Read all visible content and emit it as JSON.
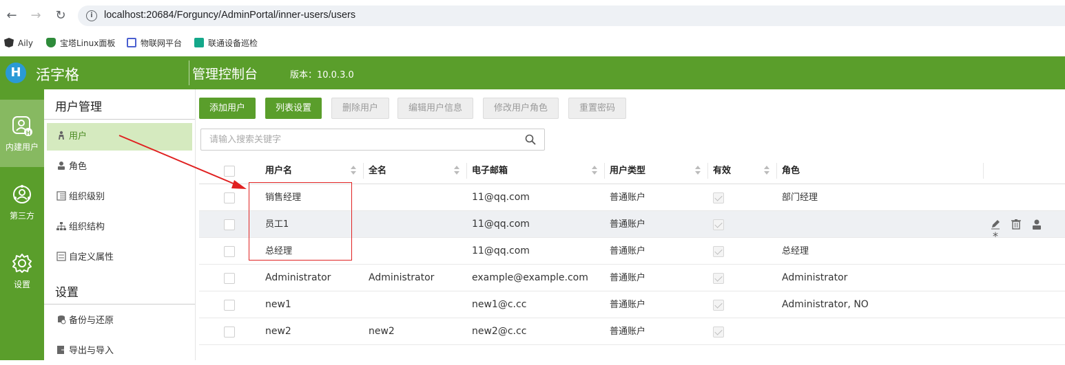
{
  "browser": {
    "url": "localhost:20684/Forguncy/AdminPortal/inner-users/users",
    "bookmarks": [
      {
        "label": "Aily",
        "icon": "angular-icon"
      },
      {
        "label": "宝塔Linux面板",
        "icon": "shield-icon"
      },
      {
        "label": "物联网平台",
        "icon": "cube-icon"
      },
      {
        "label": "联通设备巡检",
        "icon": "play-icon"
      }
    ]
  },
  "header": {
    "logo_letter": "H",
    "brand": "活字格",
    "title": "管理控制台",
    "version": "版本：10.0.3.0"
  },
  "rail": [
    {
      "label": "内建用户",
      "icon": "inner-user-icon",
      "active": true
    },
    {
      "label": "第三方",
      "icon": "third-party-icon",
      "active": false
    },
    {
      "label": "设置",
      "icon": "gear-icon",
      "active": false
    }
  ],
  "subnav": {
    "group1": "用户管理",
    "items1": [
      {
        "label": "用户",
        "icon": "user-icon"
      },
      {
        "label": "角色",
        "icon": "role-icon"
      },
      {
        "label": "组织级别",
        "icon": "org-level-icon"
      },
      {
        "label": "组织结构",
        "icon": "org-structure-icon"
      },
      {
        "label": "自定义属性",
        "icon": "custom-attribute-icon"
      }
    ],
    "group2": "设置",
    "items2": [
      {
        "label": "备份与还原",
        "icon": "backup-icon"
      },
      {
        "label": "导出与导入",
        "icon": "export-import-icon"
      }
    ]
  },
  "toolbar": {
    "add_user": "添加用户",
    "list_settings": "列表设置",
    "delete_user": "删除用户",
    "edit_user_info": "编辑用户信息",
    "modify_user_roles": "修改用户角色",
    "reset_password": "重置密码"
  },
  "search": {
    "placeholder": "请输入搜索关键字"
  },
  "table": {
    "columns": {
      "username": "用户名",
      "fullname": "全名",
      "email": "电子邮箱",
      "user_type": "用户类型",
      "valid": "有效",
      "role": "角色"
    },
    "rows": [
      {
        "username": "销售经理",
        "fullname": "",
        "email": "11@qq.com",
        "user_type": "普通账户",
        "valid": true,
        "role": "部门经理"
      },
      {
        "username": "员工1",
        "fullname": "",
        "email": "11@qq.com",
        "user_type": "普通账户",
        "valid": true,
        "role": ""
      },
      {
        "username": "总经理",
        "fullname": "",
        "email": "11@qq.com",
        "user_type": "普通账户",
        "valid": true,
        "role": "总经理"
      },
      {
        "username": "Administrator",
        "fullname": "Administrator",
        "email": "example@example.com",
        "user_type": "普通账户",
        "valid": true,
        "role": "Administrator"
      },
      {
        "username": "new1",
        "fullname": "",
        "email": "new1@c.cc",
        "user_type": "普通账户",
        "valid": true,
        "role": "Administrator, NO"
      },
      {
        "username": "new2",
        "fullname": "new2",
        "email": "new2@c.cc",
        "user_type": "普通账户",
        "valid": true,
        "role": ""
      }
    ],
    "row_actions": [
      "edit-icon",
      "trash-icon",
      "user-role-icon",
      "asterisk-icon"
    ]
  },
  "colors": {
    "brand_green": "#5a9e2b",
    "active_nav": "#d5eabf",
    "annotation_red": "#e02020"
  }
}
